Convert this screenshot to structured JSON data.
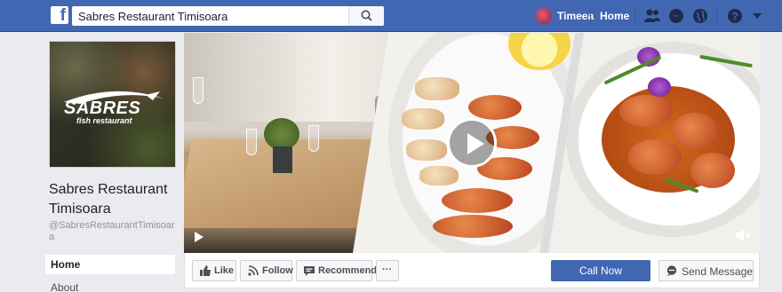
{
  "topbar": {
    "search_value": "Sabres Restaurant Timisoara",
    "user_name": "Timeea",
    "home_label": "Home",
    "brand_color": "#4267b2",
    "icons": [
      "facebook-logo-icon",
      "search-icon",
      "friends-icon",
      "messenger-icon",
      "globe-notifications-icon",
      "help-icon",
      "caret-down-icon"
    ]
  },
  "page": {
    "logo_brand": "SABRES",
    "logo_subtitle": "fish restaurant",
    "name": "Sabres Restaurant Timisoara",
    "handle": "@SabresRestaurantTimisoara"
  },
  "nav": {
    "home": "Home",
    "about": "About"
  },
  "actions": {
    "like": "Like",
    "follow": "Follow",
    "recommend": "Recommend",
    "more": "···",
    "call_now": "Call Now",
    "send_message": "Send Message"
  }
}
